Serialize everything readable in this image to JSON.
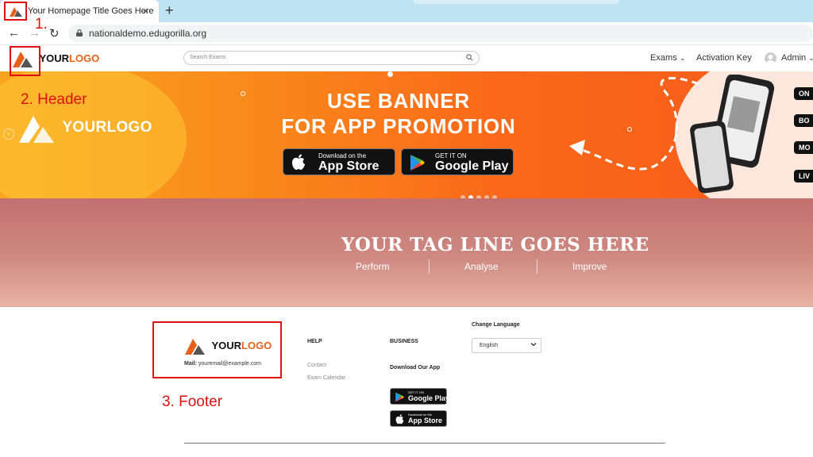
{
  "browser": {
    "tab_title": "Your Homepage Title Goes Here",
    "close_glyph": "×",
    "new_tab_glyph": "+",
    "url": "nationaldemo.edugorilla.org",
    "back_glyph": "←",
    "forward_glyph": "→",
    "reload_glyph": "↻"
  },
  "logo": {
    "prefix": "YOUR",
    "suffix": "LOGO"
  },
  "header": {
    "search_placeholder": "Search Exams",
    "nav": [
      "Exams",
      "Activation Key",
      "Admin"
    ],
    "exams_chevron": "⌄",
    "admin_chevron": "⌄"
  },
  "banner": {
    "line1": "USE BANNER",
    "line2": "FOR APP PROMOTION",
    "app_store_small": "Download on the",
    "app_store_big": "App Store",
    "google_small": "GET IT ON",
    "google_big": "Google Play",
    "side_buttons": [
      "ON",
      "BO",
      "MO",
      "LIV"
    ],
    "slides": 5,
    "active_slide": 1
  },
  "tagline": {
    "title": "YOUR TAG LINE GOES HERE",
    "items": [
      "Perform",
      "Analyse",
      "Improve"
    ]
  },
  "footer": {
    "mail_label": "Mail:",
    "mail_value": "youremail@example.com",
    "help_heading": "HELP",
    "help_links": [
      "Contact",
      "Exam Calendar"
    ],
    "business_heading": "BUSINESS",
    "download_heading": "Download Our App",
    "language_heading": "Change Language",
    "language_value": "English",
    "google_small": "GET IT ON",
    "google_big": "Google Play",
    "apple_small": "Download on the",
    "apple_big": "App Store"
  },
  "annotations": {
    "a1": "1.",
    "a2": "2. Header",
    "a3": "3. Footer"
  },
  "colors": {
    "annotation": "#e01010",
    "accent_orange": "#e8611a",
    "tab_strip": "#bfe3f0"
  }
}
